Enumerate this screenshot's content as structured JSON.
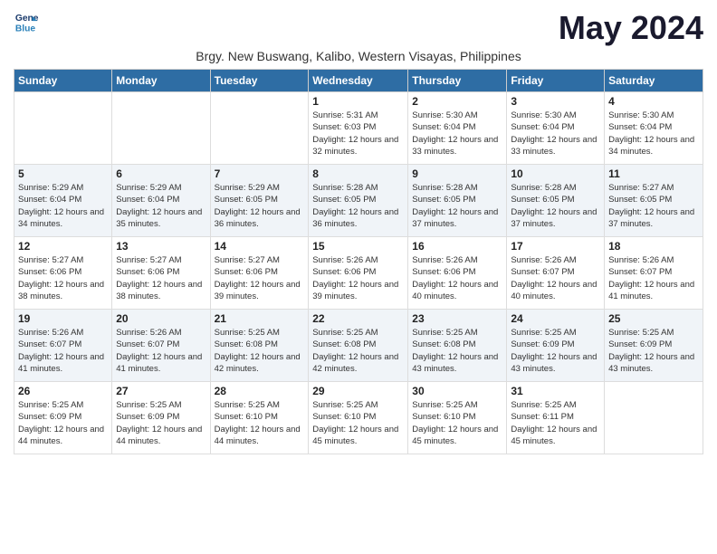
{
  "header": {
    "logo_line1": "General",
    "logo_line2": "Blue",
    "month_year": "May 2024",
    "location": "Brgy. New Buswang, Kalibo, Western Visayas, Philippines"
  },
  "days_of_week": [
    "Sunday",
    "Monday",
    "Tuesday",
    "Wednesday",
    "Thursday",
    "Friday",
    "Saturday"
  ],
  "weeks": [
    [
      {
        "day": "",
        "sunrise": "",
        "sunset": "",
        "daylight": ""
      },
      {
        "day": "",
        "sunrise": "",
        "sunset": "",
        "daylight": ""
      },
      {
        "day": "",
        "sunrise": "",
        "sunset": "",
        "daylight": ""
      },
      {
        "day": "1",
        "sunrise": "Sunrise: 5:31 AM",
        "sunset": "Sunset: 6:03 PM",
        "daylight": "Daylight: 12 hours and 32 minutes."
      },
      {
        "day": "2",
        "sunrise": "Sunrise: 5:30 AM",
        "sunset": "Sunset: 6:04 PM",
        "daylight": "Daylight: 12 hours and 33 minutes."
      },
      {
        "day": "3",
        "sunrise": "Sunrise: 5:30 AM",
        "sunset": "Sunset: 6:04 PM",
        "daylight": "Daylight: 12 hours and 33 minutes."
      },
      {
        "day": "4",
        "sunrise": "Sunrise: 5:30 AM",
        "sunset": "Sunset: 6:04 PM",
        "daylight": "Daylight: 12 hours and 34 minutes."
      }
    ],
    [
      {
        "day": "5",
        "sunrise": "Sunrise: 5:29 AM",
        "sunset": "Sunset: 6:04 PM",
        "daylight": "Daylight: 12 hours and 34 minutes."
      },
      {
        "day": "6",
        "sunrise": "Sunrise: 5:29 AM",
        "sunset": "Sunset: 6:04 PM",
        "daylight": "Daylight: 12 hours and 35 minutes."
      },
      {
        "day": "7",
        "sunrise": "Sunrise: 5:29 AM",
        "sunset": "Sunset: 6:05 PM",
        "daylight": "Daylight: 12 hours and 36 minutes."
      },
      {
        "day": "8",
        "sunrise": "Sunrise: 5:28 AM",
        "sunset": "Sunset: 6:05 PM",
        "daylight": "Daylight: 12 hours and 36 minutes."
      },
      {
        "day": "9",
        "sunrise": "Sunrise: 5:28 AM",
        "sunset": "Sunset: 6:05 PM",
        "daylight": "Daylight: 12 hours and 37 minutes."
      },
      {
        "day": "10",
        "sunrise": "Sunrise: 5:28 AM",
        "sunset": "Sunset: 6:05 PM",
        "daylight": "Daylight: 12 hours and 37 minutes."
      },
      {
        "day": "11",
        "sunrise": "Sunrise: 5:27 AM",
        "sunset": "Sunset: 6:05 PM",
        "daylight": "Daylight: 12 hours and 37 minutes."
      }
    ],
    [
      {
        "day": "12",
        "sunrise": "Sunrise: 5:27 AM",
        "sunset": "Sunset: 6:06 PM",
        "daylight": "Daylight: 12 hours and 38 minutes."
      },
      {
        "day": "13",
        "sunrise": "Sunrise: 5:27 AM",
        "sunset": "Sunset: 6:06 PM",
        "daylight": "Daylight: 12 hours and 38 minutes."
      },
      {
        "day": "14",
        "sunrise": "Sunrise: 5:27 AM",
        "sunset": "Sunset: 6:06 PM",
        "daylight": "Daylight: 12 hours and 39 minutes."
      },
      {
        "day": "15",
        "sunrise": "Sunrise: 5:26 AM",
        "sunset": "Sunset: 6:06 PM",
        "daylight": "Daylight: 12 hours and 39 minutes."
      },
      {
        "day": "16",
        "sunrise": "Sunrise: 5:26 AM",
        "sunset": "Sunset: 6:06 PM",
        "daylight": "Daylight: 12 hours and 40 minutes."
      },
      {
        "day": "17",
        "sunrise": "Sunrise: 5:26 AM",
        "sunset": "Sunset: 6:07 PM",
        "daylight": "Daylight: 12 hours and 40 minutes."
      },
      {
        "day": "18",
        "sunrise": "Sunrise: 5:26 AM",
        "sunset": "Sunset: 6:07 PM",
        "daylight": "Daylight: 12 hours and 41 minutes."
      }
    ],
    [
      {
        "day": "19",
        "sunrise": "Sunrise: 5:26 AM",
        "sunset": "Sunset: 6:07 PM",
        "daylight": "Daylight: 12 hours and 41 minutes."
      },
      {
        "day": "20",
        "sunrise": "Sunrise: 5:26 AM",
        "sunset": "Sunset: 6:07 PM",
        "daylight": "Daylight: 12 hours and 41 minutes."
      },
      {
        "day": "21",
        "sunrise": "Sunrise: 5:25 AM",
        "sunset": "Sunset: 6:08 PM",
        "daylight": "Daylight: 12 hours and 42 minutes."
      },
      {
        "day": "22",
        "sunrise": "Sunrise: 5:25 AM",
        "sunset": "Sunset: 6:08 PM",
        "daylight": "Daylight: 12 hours and 42 minutes."
      },
      {
        "day": "23",
        "sunrise": "Sunrise: 5:25 AM",
        "sunset": "Sunset: 6:08 PM",
        "daylight": "Daylight: 12 hours and 43 minutes."
      },
      {
        "day": "24",
        "sunrise": "Sunrise: 5:25 AM",
        "sunset": "Sunset: 6:09 PM",
        "daylight": "Daylight: 12 hours and 43 minutes."
      },
      {
        "day": "25",
        "sunrise": "Sunrise: 5:25 AM",
        "sunset": "Sunset: 6:09 PM",
        "daylight": "Daylight: 12 hours and 43 minutes."
      }
    ],
    [
      {
        "day": "26",
        "sunrise": "Sunrise: 5:25 AM",
        "sunset": "Sunset: 6:09 PM",
        "daylight": "Daylight: 12 hours and 44 minutes."
      },
      {
        "day": "27",
        "sunrise": "Sunrise: 5:25 AM",
        "sunset": "Sunset: 6:09 PM",
        "daylight": "Daylight: 12 hours and 44 minutes."
      },
      {
        "day": "28",
        "sunrise": "Sunrise: 5:25 AM",
        "sunset": "Sunset: 6:10 PM",
        "daylight": "Daylight: 12 hours and 44 minutes."
      },
      {
        "day": "29",
        "sunrise": "Sunrise: 5:25 AM",
        "sunset": "Sunset: 6:10 PM",
        "daylight": "Daylight: 12 hours and 45 minutes."
      },
      {
        "day": "30",
        "sunrise": "Sunrise: 5:25 AM",
        "sunset": "Sunset: 6:10 PM",
        "daylight": "Daylight: 12 hours and 45 minutes."
      },
      {
        "day": "31",
        "sunrise": "Sunrise: 5:25 AM",
        "sunset": "Sunset: 6:11 PM",
        "daylight": "Daylight: 12 hours and 45 minutes."
      },
      {
        "day": "",
        "sunrise": "",
        "sunset": "",
        "daylight": ""
      }
    ]
  ]
}
